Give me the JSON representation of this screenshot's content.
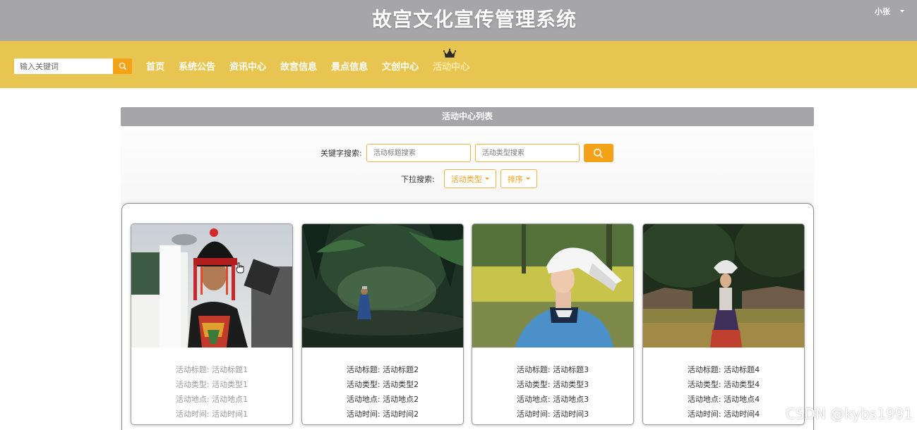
{
  "header": {
    "title": "故宫文化宣传管理系统",
    "user": "小张"
  },
  "nav": {
    "search_placeholder": "输入关键词",
    "items": [
      {
        "label": "首页"
      },
      {
        "label": "系统公告"
      },
      {
        "label": "资讯中心"
      },
      {
        "label": "故宫信息"
      },
      {
        "label": "景点信息"
      },
      {
        "label": "文创中心"
      },
      {
        "label": "活动中心"
      }
    ],
    "active_index": 6,
    "colors": {
      "bar": "#e8c550",
      "header": "#a6a6a8",
      "accent": "#f4a319"
    }
  },
  "section": {
    "title": "活动中心列表"
  },
  "search": {
    "keyword_label": "关键字搜索:",
    "title_placeholder": "活动标题搜索",
    "type_placeholder": "活动类型搜索",
    "dropdown_label": "下拉搜索:",
    "type_dropdown": "活动类型",
    "sort_dropdown": "排序"
  },
  "cards": [
    {
      "title_label": "活动标题:",
      "title": "活动标题1",
      "type_label": "活动类型:",
      "type": "活动类型1",
      "place_label": "活动地点:",
      "place": "活动地点1",
      "time_label": "活动时间:",
      "time": "活动时间1"
    },
    {
      "title_label": "活动标题:",
      "title": "活动标题2",
      "type_label": "活动类型:",
      "type": "活动类型2",
      "place_label": "活动地点:",
      "place": "活动地点2",
      "time_label": "活动时间:",
      "time": "活动时间2"
    },
    {
      "title_label": "活动标题:",
      "title": "活动标题3",
      "type_label": "活动类型:",
      "type": "活动类型3",
      "place_label": "活动地点:",
      "place": "活动地点3",
      "time_label": "活动时间:",
      "time": "活动时间3"
    },
    {
      "title_label": "活动标题:",
      "title": "活动标题4",
      "type_label": "活动类型:",
      "type": "活动类型4",
      "place_label": "活动地点:",
      "place": "活动地点4",
      "time_label": "活动时间:",
      "time": "活动时间4"
    }
  ],
  "watermark": "CSDN @kybs1991"
}
